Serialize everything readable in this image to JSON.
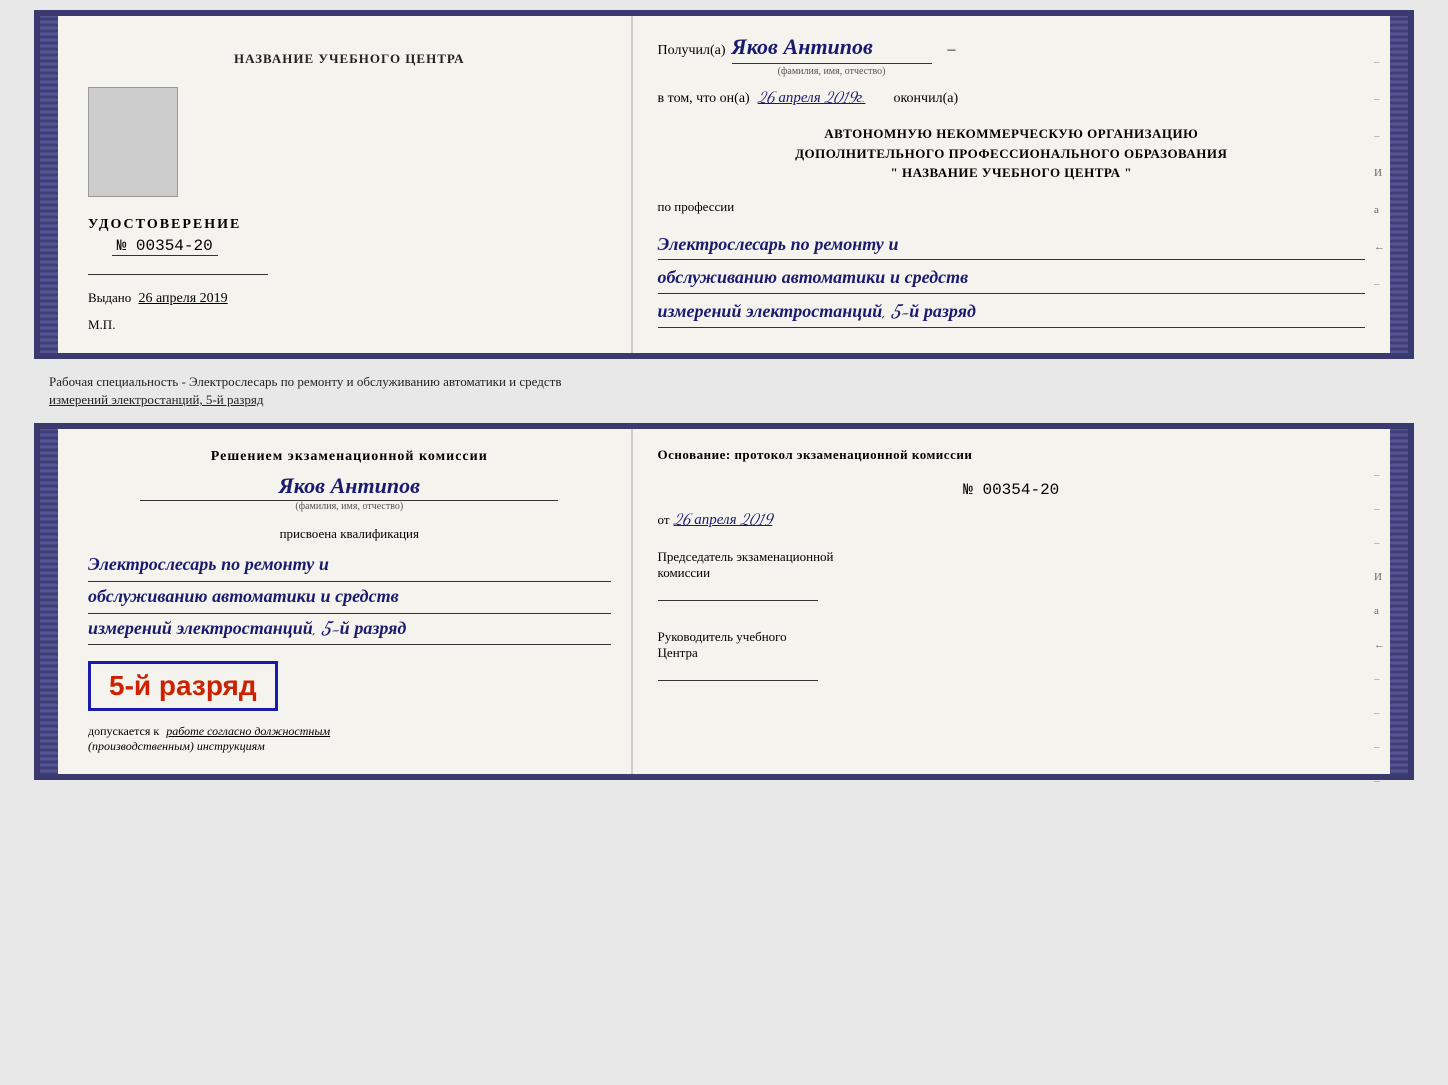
{
  "top_book": {
    "left_page": {
      "title": "НАЗВАНИЕ УЧЕБНОГО ЦЕНТРА",
      "udostoverenie_title": "УДОСТОВЕРЕНИЕ",
      "number": "№ 00354-20",
      "vydano_label": "Выдано",
      "vydano_date": "26 апреля 2019",
      "mp_label": "М.П."
    },
    "right_page": {
      "poluchil_label": "Получил(а)",
      "poluchil_name": "Яков Антипов",
      "fio_label": "(фамилия, имя, отчество)",
      "vtom_label": "в том, что он(а)",
      "vtom_date": "26 апреля 2019г.",
      "okonchil_label": "окончил(а)",
      "org_line1": "АВТОНОМНУЮ НЕКОММЕРЧЕСКУЮ ОРГАНИЗАЦИЮ",
      "org_line2": "ДОПОЛНИТЕЛЬНОГО ПРОФЕССИОНАЛЬНОГО ОБРАЗОВАНИЯ",
      "org_line3": "\"   НАЗВАНИЕ УЧЕБНОГО ЦЕНТРА   \"",
      "po_professii_label": "по профессии",
      "profession_line1": "Электрослесарь по ремонту и",
      "profession_line2": "обслуживанию автоматики и средств",
      "profession_line3": "измерений электростанций, 5-й разряд",
      "right_markers": [
        "-",
        "-",
        "-",
        "И",
        "а",
        "←",
        "-"
      ]
    }
  },
  "description": {
    "text_line1": "Рабочая специальность - Электрослесарь по ремонту и обслуживанию автоматики и средств",
    "text_line2": "измерений электростанций, 5-й разряд"
  },
  "bottom_book": {
    "left_page": {
      "resheniem_label": "Решением  экзаменационной  комиссии",
      "name": "Яков Антипов",
      "fio_label": "(фамилия, имя, отчество)",
      "prisvoena_label": "присвоена квалификация",
      "profession_line1": "Электрослесарь по ремонту и",
      "profession_line2": "обслуживанию автоматики и средств",
      "profession_line3": "измерений электростанций, 5-й разряд",
      "razryad_text": "5-й разряд",
      "dopuskaetsya_prefix": "допускается к",
      "dopuskaetsya_text": "работе согласно должностным",
      "dopuskaetsya_text2": "(производственным) инструкциям"
    },
    "right_page": {
      "osnovanie_label": "Основание: протокол  экзаменационной  комиссии",
      "number": "№  00354-20",
      "ot_label": "от",
      "ot_date": "26 апреля 2019",
      "predsedatel_label": "Председатель экзаменационной",
      "komissi_label": "комиссии",
      "rukovoditel_label": "Руководитель учебного",
      "centr_label": "Центра",
      "right_markers": [
        "-",
        "-",
        "-",
        "И",
        "а",
        "←",
        "-",
        "-",
        "-",
        "-"
      ]
    }
  }
}
